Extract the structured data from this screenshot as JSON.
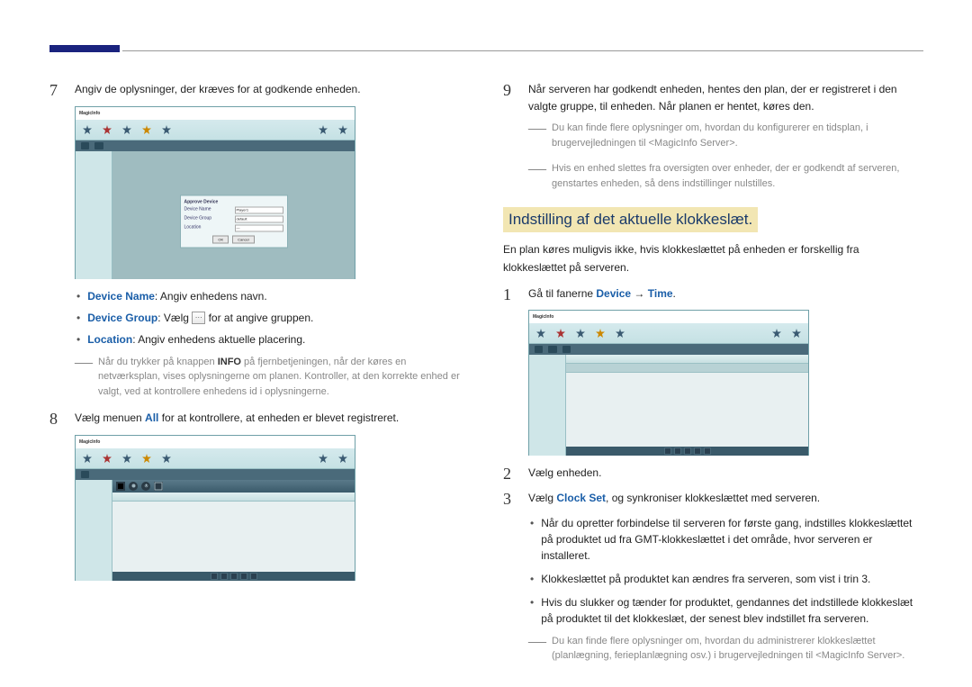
{
  "left": {
    "step7": {
      "num": "7",
      "text": "Angiv de oplysninger, der kræves for at godkende enheden."
    },
    "bullets": {
      "device_name_label": "Device Name",
      "device_name_text": ": Angiv enhedens navn.",
      "device_group_label": "Device Group",
      "device_group_text_1": ": Vælg ",
      "device_group_text_2": " for at angive gruppen.",
      "location_label": "Location",
      "location_text": ": Angiv enhedens aktuelle placering."
    },
    "note7_pre": "Når du trykker på knappen ",
    "note7_bold": "INFO",
    "note7_post": " på fjernbetjeningen, når der køres en netværksplan, vises oplysningerne om planen. Kontroller, at den korrekte enhed er valgt, ved at kontrollere enhedens id i oplysningerne.",
    "step8": {
      "num": "8",
      "pre": "Vælg menuen ",
      "all": "All",
      "post": " for at kontrollere, at enheden er blevet registreret."
    },
    "ss1": {
      "logo": "MagicInfo",
      "modal_title": "Approve Device",
      "f_name": "Device Name",
      "f_name_v": "Player1",
      "f_group": "Device Group",
      "f_group_v": "default",
      "f_loc": "Location",
      "f_loc_v": "—",
      "btn_ok": "OK",
      "btn_cancel": "Cancel"
    }
  },
  "right": {
    "step9": {
      "num": "9",
      "text": "Når serveren har godkendt enheden, hentes den plan, der er registreret i den valgte gruppe, til enheden. Når planen er hentet, køres den."
    },
    "note9a": "Du kan finde flere oplysninger om, hvordan du konfigurerer en tidsplan, i brugervejledningen til <MagicInfo Server>.",
    "note9b": "Hvis en enhed slettes fra oversigten over enheder, der er godkendt af serveren, genstartes enheden, så dens indstillinger nulstilles.",
    "section": "Indstilling af det aktuelle klokkeslæt.",
    "intro": "En plan køres muligvis ikke, hvis klokkeslættet på enheden er forskellig fra klokkeslættet på serveren.",
    "step1": {
      "num": "1",
      "pre": "Gå til fanerne ",
      "device": "Device",
      "arrow": " → ",
      "time": "Time",
      "post": "."
    },
    "step2": {
      "num": "2",
      "text": "Vælg enheden."
    },
    "step3": {
      "num": "3",
      "pre": "Vælg ",
      "clock": "Clock Set",
      "post": ", og synkroniser klokkeslættet med serveren."
    },
    "b1": "Når du opretter forbindelse til serveren for første gang, indstilles klokkeslættet på produktet ud fra GMT-klokkeslættet i det område, hvor serveren er installeret.",
    "b2": "Klokkeslættet på produktet kan ændres fra serveren, som vist i trin 3.",
    "b3": "Hvis du slukker og tænder for produktet, gendannes det indstillede klokkeslæt på produktet til det klokkeslæt, der senest blev indstillet fra serveren.",
    "noteEnd": "Du kan finde flere oplysninger om, hvordan du administrerer klokkeslættet (planlægning, ferieplanlægning osv.) i brugervejledningen til <MagicInfo Server>."
  }
}
